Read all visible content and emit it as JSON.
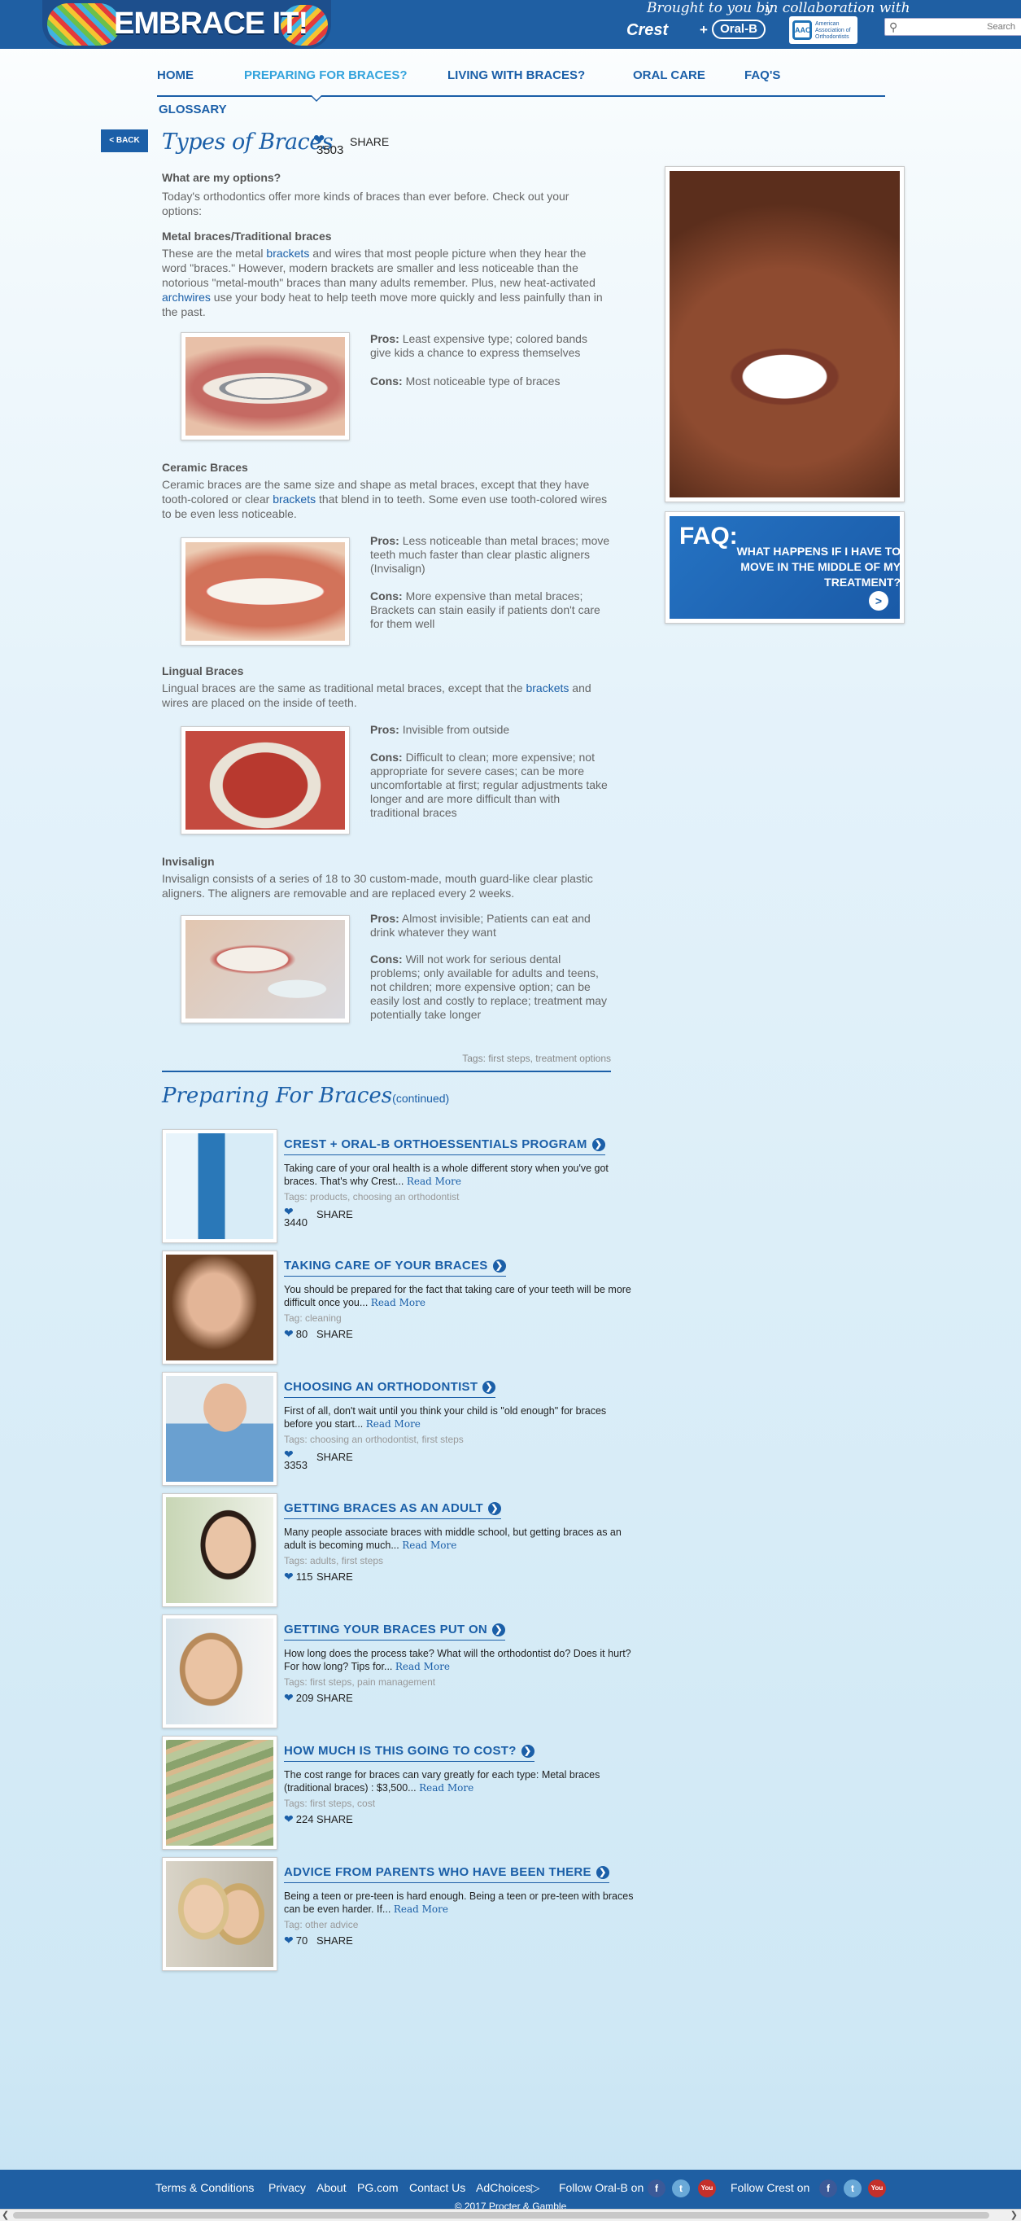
{
  "header": {
    "logo_text": "EMBRACE IT!",
    "brought_by": "Brought to you by",
    "collaboration": "in collaboration with",
    "brand1": "Crest",
    "brand_plus": "+",
    "brand2": "Oral-B",
    "aao_mark": "AAO",
    "aao_name": "American Association of Orthodontists",
    "search_placeholder": "Search"
  },
  "nav": {
    "items": [
      "HOME",
      "PREPARING FOR BRACES?",
      "LIVING WITH BRACES?",
      "ORAL CARE",
      "FAQ'S",
      "GLOSSARY"
    ]
  },
  "page": {
    "back_label": "< BACK",
    "title": "Types of Braces",
    "likes": "3503",
    "share": "SHARE"
  },
  "article": {
    "heading": "What are my options?",
    "intro": "Today's orthodontics offer more kinds of braces than ever before. Check out your options:",
    "sections": [
      {
        "title": "Metal braces/Traditional braces",
        "body_a": "These are the metal ",
        "link1": "brackets",
        "body_b": " and wires that most people picture when they hear the word \"braces.\" However, modern brackets are smaller and less noticeable than the notorious \"metal-mouth\" braces than many adults remember. Plus, new heat-activated ",
        "link2": "archwires",
        "body_c": " use your body heat to help teeth move more quickly and less painfully than in the past.",
        "pros": "Least expensive type; colored bands give kids a chance to express themselves",
        "cons": "Most noticeable type of braces"
      },
      {
        "title": "Ceramic Braces",
        "body_a": "Ceramic braces are the same size and shape as metal braces, except that they have tooth-colored or clear ",
        "link1": "brackets",
        "body_b": " that blend in to teeth. Some even use tooth-colored wires to be even less noticeable.",
        "pros": "Less noticeable than metal braces; move teeth much faster than clear plastic aligners (Invisalign)",
        "cons": "More expensive than metal braces; Brackets can stain easily if patients don't care for them well"
      },
      {
        "title": "Lingual Braces",
        "body_a": "Lingual braces are the same as traditional metal braces, except that the ",
        "link1": "brackets",
        "body_b": " and wires are placed on the inside of teeth.",
        "pros": "Invisible from outside",
        "cons": "Difficult to clean; more expensive; not appropriate for severe cases; can be more uncomfortable at first; regular adjustments take longer and are more difficult than with traditional braces"
      },
      {
        "title": "Invisalign",
        "body_a": "Invisalign consists of a series of 18 to 30 custom-made, mouth guard-like clear plastic aligners. The aligners are removable and are replaced every 2 weeks.",
        "pros": "Almost invisible; Patients can eat and drink whatever they want",
        "cons": "Will not work for serious dental problems; only available for adults and teens, not children; more expensive option; can be easily lost and costly to replace; treatment may potentially take longer"
      }
    ],
    "pros_label": "Pros:",
    "cons_label": "Cons:",
    "tags": "Tags: first steps, treatment options"
  },
  "related": {
    "title": "Preparing For Braces",
    "continued": "(continued)",
    "read_more": "Read More",
    "share": "SHARE",
    "cards": [
      {
        "title": "CREST + ORAL-B ORTHOESSENTIALS PROGRAM",
        "desc": "Taking care of your oral health is a whole different story when you've got braces. That's why Crest...",
        "tags": "Tags: products, choosing an orthodontist",
        "likes": "3440"
      },
      {
        "title": "TAKING CARE OF YOUR BRACES",
        "desc": "You should be prepared for the fact that taking care of your teeth will be more difficult once you...",
        "tags": "Tag: cleaning",
        "likes": "80"
      },
      {
        "title": "CHOOSING AN ORTHODONTIST",
        "desc": "First of all, don't wait until you think your child is \"old enough\" for braces before you start...",
        "tags": "Tags: choosing an orthodontist, first steps",
        "likes": "3353"
      },
      {
        "title": "GETTING BRACES AS AN ADULT",
        "desc": "Many people associate braces with middle school, but getting braces as an adult is becoming much...",
        "tags": "Tags: adults, first steps",
        "likes": "115"
      },
      {
        "title": "GETTING YOUR BRACES PUT ON",
        "desc": "How long does the process take? What will the orthodontist do? Does it hurt? For how long? Tips for...",
        "tags": "Tags: first steps, pain management",
        "likes": "209"
      },
      {
        "title": "HOW MUCH IS THIS GOING TO COST?",
        "desc": "The cost range for braces can vary greatly for each type: Metal braces (traditional braces) : $3,500...",
        "tags": "Tags: first steps, cost",
        "likes": "224"
      },
      {
        "title": "ADVICE FROM PARENTS WHO HAVE BEEN THERE",
        "desc": "Being a teen or pre-teen is hard enough. Being a teen or pre-teen with braces can be even harder. If...",
        "tags": "Tag: other advice",
        "likes": "70"
      }
    ]
  },
  "sidebar": {
    "faq_label": "FAQ:",
    "faq_question": "WHAT HAPPENS IF I HAVE TO MOVE IN THE MIDDLE OF MY TREATMENT?",
    "faq_go": ">"
  },
  "footer": {
    "links": [
      "Terms & Conditions",
      "Privacy",
      "About",
      "PG.com",
      "Contact Us",
      "AdChoices"
    ],
    "follow_oralb": "Follow Oral-B on",
    "follow_crest": "Follow Crest on",
    "copyright": "© 2017 Procter & Gamble",
    "social_f": "f",
    "social_t": "t",
    "social_yt": "You"
  },
  "colors": {
    "brand_blue": "#1b5fa8",
    "header_blue": "#1f5fa3",
    "nav_active": "#33a3dc"
  }
}
